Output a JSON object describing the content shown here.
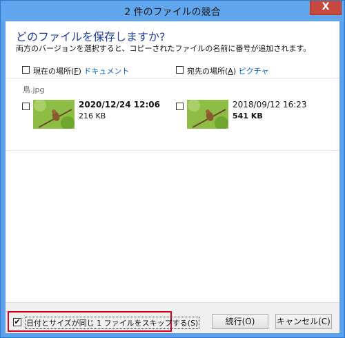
{
  "window": {
    "title": "2 件のファイルの競合",
    "close_glyph": "X"
  },
  "header": {
    "heading": "どのファイルを保存しますか?",
    "description": "両方のバージョンを選択すると、コピーされたファイルの名前に番号が追加されます。"
  },
  "source": {
    "label_prefix": "現在の場所(",
    "label_key": "F",
    "label_suffix": ")",
    "location": "ドキュメント"
  },
  "destination": {
    "label_prefix": "宛先の場所(",
    "label_key": "A",
    "label_suffix": ")",
    "location": "ピクチャ"
  },
  "conflict": {
    "file_name": "鳥.jpg",
    "source_file": {
      "date": "2020/12/24 12:06",
      "size": "216 KB"
    },
    "destination_file": {
      "date": "2018/09/12 16:23",
      "size": "541 KB"
    }
  },
  "footer": {
    "skip_label": "日付とサイズが同じ 1 ファイルをスキップする(S)",
    "continue_label": "続行(O)",
    "cancel_label": "キャンセル(C)"
  }
}
